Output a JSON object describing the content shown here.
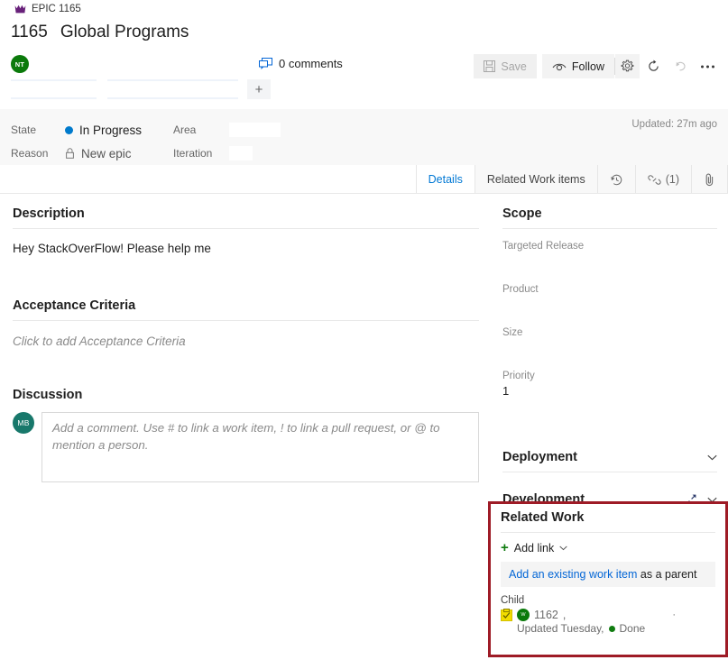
{
  "header": {
    "breadcrumb": "EPIC 1165",
    "work_item_id": "1165",
    "work_item_title": "Global Programs",
    "author_avatar_initials": "NT",
    "comments_label": "0 comments"
  },
  "toolbar": {
    "save_label": "Save",
    "follow_label": "Follow",
    "settings_icon": "gear-icon",
    "refresh_icon": "refresh-icon",
    "undo_icon": "undo-icon",
    "more_icon": "ellipsis-icon"
  },
  "fields": {
    "state_label": "State",
    "state_value": "In Progress",
    "state_color": "#007acc",
    "reason_label": "Reason",
    "reason_value": "New epic",
    "area_label": "Area",
    "area_value": "",
    "iteration_label": "Iteration",
    "iteration_value": "",
    "updated_text": "Updated: 27m ago"
  },
  "tabs": [
    {
      "label": "Details",
      "active": true
    },
    {
      "label": "Related Work items",
      "active": false
    },
    {
      "label": "",
      "icon": "history-clock-icon",
      "active": false
    },
    {
      "label": "(1)",
      "icon": "link-icon",
      "active": false
    },
    {
      "label": "",
      "icon": "paperclip-icon",
      "active": false
    }
  ],
  "main": {
    "description_heading": "Description",
    "description_text": "Hey StackOverFlow! Please help me",
    "acceptance_heading": "Acceptance Criteria",
    "acceptance_placeholder": "Click to add Acceptance Criteria",
    "discussion_heading": "Discussion",
    "discussion_avatar_initials": "MB",
    "comment_placeholder": "Add a comment. Use # to link a work item, ! to link a pull request, or @ to mention a person."
  },
  "sidebar": {
    "scope_heading": "Scope",
    "scope_fields": [
      {
        "label": "Targeted Release",
        "value": ""
      },
      {
        "label": "Product",
        "value": ""
      },
      {
        "label": "Size",
        "value": ""
      },
      {
        "label": "Priority",
        "value": "1"
      }
    ],
    "deployment_heading": "Deployment",
    "development_heading": "Development"
  },
  "related_work": {
    "heading": "Related Work",
    "add_link_label": "Add link",
    "suggestion_link": "Add an existing work item",
    "suggestion_suffix": " as a parent",
    "group_label": "Child",
    "item_id": "1162",
    "item_separator": ",",
    "item_updated": "Updated Tuesday,",
    "item_state": "Done",
    "item_state_color": "#107c10",
    "item_avatar_initials": "W",
    "highlight_color": "#9e1b26"
  }
}
